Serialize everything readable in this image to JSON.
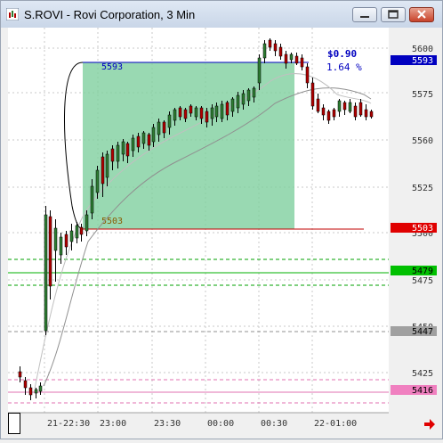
{
  "window": {
    "title": "S.ROVI - Rovi Corporation, 3 Min",
    "buttons": [
      "minimize",
      "maximize",
      "close"
    ]
  },
  "price_axis": {
    "ticks": [
      "5600",
      "5575",
      "5560",
      "5525",
      "5500",
      "5475",
      "5450",
      "5425"
    ]
  },
  "time_axis": {
    "ticks": [
      "21-22:30",
      "23:00",
      "23:30",
      "00:00",
      "00:30",
      "22-01:00"
    ]
  },
  "annotation": {
    "top_level": "5593",
    "bottom_level": "5503",
    "change": "$0.90",
    "change_pct": "1.64 %"
  },
  "level_markers": [
    {
      "label": "5593",
      "color": "#0000c0"
    },
    {
      "label": "5503",
      "color": "#e00000"
    },
    {
      "label": "5479",
      "color": "#00c000"
    },
    {
      "label": "5447",
      "color": "#a0a0a0"
    },
    {
      "label": "5416",
      "color": "#f080c0"
    }
  ],
  "colors": {
    "up_candle": "#2e7d32",
    "down_candle": "#b00000",
    "measure_box": "#7fcf9f",
    "accent": "#0000c0"
  }
}
